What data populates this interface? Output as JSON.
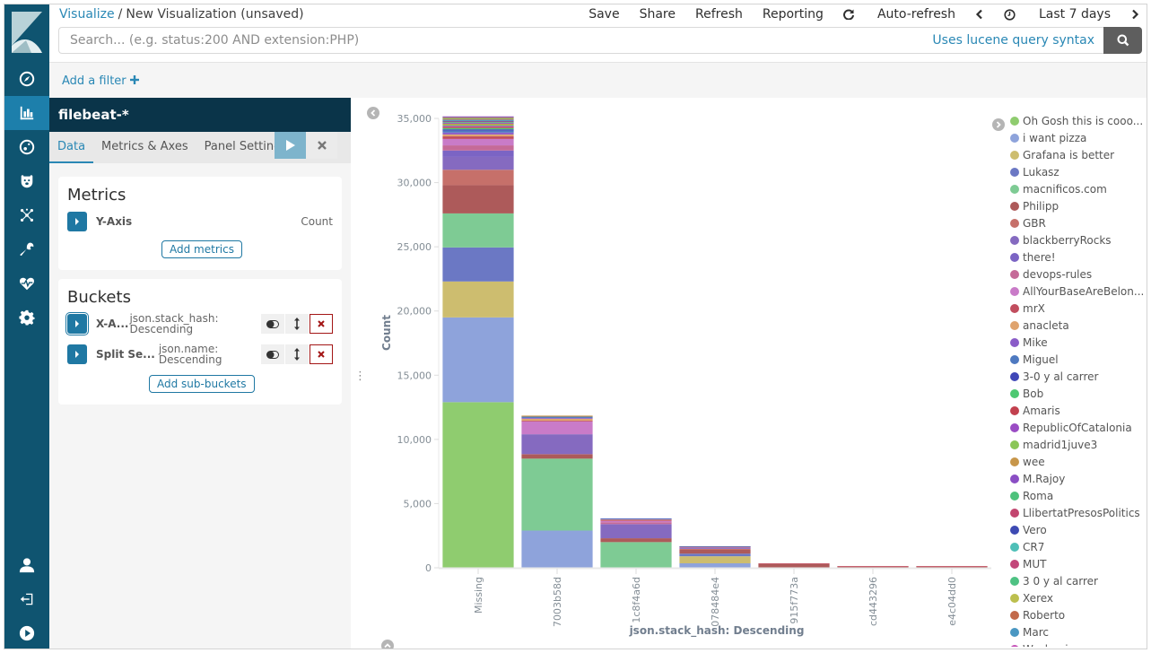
{
  "breadcrumb": {
    "parent": "Visualize",
    "separator": "/",
    "current": "New Visualization (unsaved)"
  },
  "top_menu": {
    "save": "Save",
    "share": "Share",
    "refresh": "Refresh",
    "reporting": "Reporting",
    "auto_refresh": "Auto-refresh",
    "time_range": "Last 7 days"
  },
  "search": {
    "placeholder": "Search... (e.g. status:200 AND extension:PHP)",
    "value": "",
    "syntax_link": "Uses lucene query syntax"
  },
  "filter_bar": {
    "add_filter": "Add a filter"
  },
  "sidebar": {
    "items": [
      {
        "name": "discover",
        "icon": "compass-icon"
      },
      {
        "name": "visualize",
        "icon": "bar-chart-icon",
        "active": true
      },
      {
        "name": "dashboard",
        "icon": "dashboard-icon"
      },
      {
        "name": "timelion",
        "icon": "bear-icon"
      },
      {
        "name": "graph",
        "icon": "graph-icon"
      },
      {
        "name": "dev-tools",
        "icon": "wrench-icon"
      },
      {
        "name": "monitoring",
        "icon": "heartbeat-icon"
      },
      {
        "name": "management",
        "icon": "gear-icon"
      }
    ],
    "bottom": [
      {
        "name": "user",
        "icon": "user-icon"
      },
      {
        "name": "logout",
        "icon": "logout-icon"
      },
      {
        "name": "collapse",
        "icon": "play-circle-icon"
      }
    ]
  },
  "editor": {
    "index_pattern": "filebeat-*",
    "tabs": [
      "Data",
      "Metrics & Axes",
      "Panel Settings"
    ],
    "active_tab": "Data",
    "metrics": {
      "title": "Metrics",
      "items": [
        {
          "label": "Y-Axis",
          "value": "Count"
        }
      ],
      "add_button": "Add metrics"
    },
    "buckets": {
      "title": "Buckets",
      "items": [
        {
          "label": "X-A...",
          "desc_line1": "json.stack_hash:",
          "desc_line2": "Descending"
        },
        {
          "label": "Split Se...",
          "desc_line1": "json.name:",
          "desc_line2": "Descending"
        }
      ],
      "add_button": "Add sub-buckets"
    }
  },
  "chart_data": {
    "type": "bar",
    "stacked": true,
    "title": "",
    "xlabel": "json.stack_hash: Descending",
    "ylabel": "Count",
    "ylim": [
      0,
      35000
    ],
    "yticks": [
      0,
      5000,
      10000,
      15000,
      20000,
      25000,
      30000,
      35000
    ],
    "ytick_labels": [
      "0",
      "5,000",
      "10,000",
      "15,000",
      "20,000",
      "25,000",
      "30,000",
      "35,000"
    ],
    "grid": false,
    "legend_position": "right",
    "categories": [
      "Missing",
      "7003b58d",
      "1c8f4a6d",
      "078484e4",
      "915f773a",
      "cd443296",
      "e4c04dd0"
    ],
    "series": [
      {
        "name": "Oh Gosh this is cooo...",
        "color": "#8fcc6f",
        "values": [
          12900,
          0,
          0,
          0,
          0,
          0,
          0
        ]
      },
      {
        "name": "i want pizza",
        "color": "#8ea3db",
        "values": [
          6600,
          2900,
          0,
          350,
          0,
          0,
          0
        ]
      },
      {
        "name": "Grafana is better",
        "color": "#cdbd6f",
        "values": [
          2800,
          0,
          0,
          550,
          0,
          0,
          0
        ]
      },
      {
        "name": "Lukasz",
        "color": "#6b78c4",
        "values": [
          2650,
          0,
          0,
          200,
          0,
          0,
          0
        ]
      },
      {
        "name": "macnificos.com",
        "color": "#7ecb94",
        "values": [
          2650,
          5600,
          2000,
          0,
          0,
          0,
          0
        ]
      },
      {
        "name": "Philipp",
        "color": "#ad5a5a",
        "values": [
          2200,
          350,
          300,
          300,
          300,
          110,
          110
        ]
      },
      {
        "name": "GBR",
        "color": "#c6706a",
        "values": [
          1200,
          0,
          0,
          80,
          0,
          0,
          0
        ]
      },
      {
        "name": "blackberryRocks",
        "color": "#856ac0",
        "values": [
          1000,
          1550,
          1100,
          0,
          0,
          0,
          0
        ]
      },
      {
        "name": "there!",
        "color": "#7b64c4",
        "values": [
          500,
          0,
          0,
          80,
          0,
          0,
          0
        ]
      },
      {
        "name": "devops-rules",
        "color": "#c56a98",
        "values": [
          400,
          0,
          150,
          60,
          0,
          0,
          0
        ]
      },
      {
        "name": "AllYourBaseAreBelon...",
        "color": "#c97bc8",
        "values": [
          500,
          1000,
          100,
          0,
          0,
          0,
          0
        ]
      },
      {
        "name": "mrX",
        "color": "#c14d5e",
        "values": [
          200,
          60,
          80,
          40,
          50,
          20,
          20
        ]
      },
      {
        "name": "anacleta",
        "color": "#dfa36e",
        "values": [
          150,
          150,
          40,
          0,
          0,
          0,
          0
        ]
      },
      {
        "name": "Mike",
        "color": "#8a5cc8",
        "values": [
          150,
          60,
          40,
          0,
          0,
          0,
          0
        ]
      },
      {
        "name": "Miguel",
        "color": "#4e79c0",
        "values": [
          150,
          100,
          40,
          20,
          0,
          0,
          0
        ]
      },
      {
        "name": "3-0 y al carrer",
        "color": "#3f47b7",
        "values": [
          100,
          0,
          0,
          0,
          0,
          0,
          0
        ]
      },
      {
        "name": "Bob",
        "color": "#4ec872",
        "values": [
          100,
          0,
          0,
          0,
          0,
          0,
          0
        ]
      },
      {
        "name": "Amaris",
        "color": "#c2404e",
        "values": [
          100,
          0,
          0,
          0,
          0,
          0,
          0
        ]
      },
      {
        "name": "RepublicOfCatalonia",
        "color": "#9a4cc4",
        "values": [
          80,
          0,
          0,
          0,
          0,
          0,
          0
        ]
      },
      {
        "name": "madrid1juve3",
        "color": "#8ac657",
        "values": [
          80,
          0,
          0,
          0,
          0,
          0,
          0
        ]
      },
      {
        "name": "wee",
        "color": "#c7964a",
        "values": [
          80,
          80,
          0,
          0,
          0,
          0,
          0
        ]
      },
      {
        "name": "M.Rajoy",
        "color": "#8a4ec4",
        "values": [
          60,
          0,
          0,
          0,
          0,
          0,
          0
        ]
      },
      {
        "name": "Roma",
        "color": "#4ec27c",
        "values": [
          60,
          0,
          0,
          0,
          0,
          0,
          0
        ]
      },
      {
        "name": "LlibertatPresosPolitics",
        "color": "#c2456f",
        "values": [
          60,
          0,
          0,
          0,
          0,
          0,
          0
        ]
      },
      {
        "name": "Vero",
        "color": "#3d4ab3",
        "values": [
          50,
          0,
          0,
          0,
          0,
          0,
          0
        ]
      },
      {
        "name": "CR7",
        "color": "#4ebfb7",
        "values": [
          50,
          0,
          0,
          0,
          0,
          0,
          0
        ]
      },
      {
        "name": "MUT",
        "color": "#c2477a",
        "values": [
          50,
          0,
          0,
          0,
          0,
          0,
          0
        ]
      },
      {
        "name": "3 0 y al carrer",
        "color": "#4ec283",
        "values": [
          50,
          0,
          0,
          0,
          0,
          0,
          0
        ]
      },
      {
        "name": "Xerex",
        "color": "#bcbf4e",
        "values": [
          50,
          0,
          0,
          0,
          0,
          0,
          0
        ]
      },
      {
        "name": "Roberto",
        "color": "#c2694a",
        "values": [
          50,
          0,
          0,
          0,
          0,
          0,
          0
        ]
      },
      {
        "name": "Marc",
        "color": "#4a97c2",
        "values": [
          50,
          0,
          0,
          0,
          0,
          0,
          0
        ]
      },
      {
        "name": "Washouisa",
        "color": "#c44fb6",
        "values": [
          40,
          0,
          0,
          0,
          0,
          0,
          0
        ]
      }
    ]
  }
}
